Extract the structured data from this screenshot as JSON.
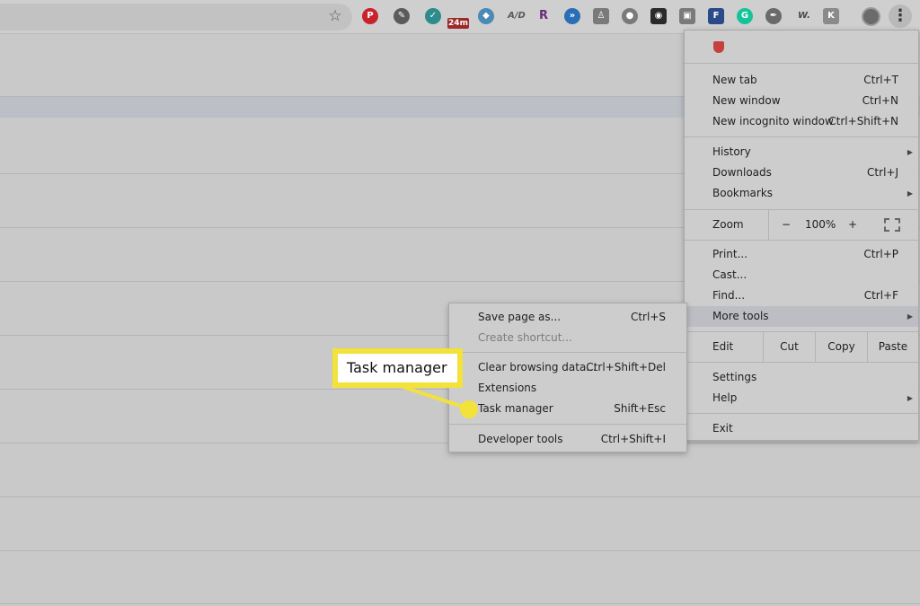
{
  "toolbar": {
    "star_icon": "bookmark-star-icon",
    "extensions": [
      {
        "name": "pinterest-icon",
        "color": "#c8232c",
        "glyph": "P"
      },
      {
        "name": "eyedropper-icon",
        "color": "#5b5b5b",
        "glyph": "✎"
      },
      {
        "name": "shield-check-icon",
        "color": "#2e8b8b",
        "glyph": "✓"
      },
      {
        "name": "badge-24m-icon",
        "color": "#9c2a2a",
        "glyph": "24m"
      },
      {
        "name": "diamond-icon",
        "color": "#4a8ab5",
        "glyph": "◆"
      },
      {
        "name": "aid-icon",
        "color": "#5a5a5a",
        "glyph": "A/D"
      },
      {
        "name": "r-icon",
        "color": "#6b2a7a",
        "glyph": "R"
      },
      {
        "name": "arrows-icon",
        "color": "#2a6fb5",
        "glyph": "»"
      },
      {
        "name": "person-icon",
        "color": "#7a7a7a",
        "glyph": "♙"
      },
      {
        "name": "acorn-icon",
        "color": "#7a7a7a",
        "glyph": "●"
      },
      {
        "name": "owl-icon",
        "color": "#2a2a2a",
        "glyph": "◉"
      },
      {
        "name": "briefcase-icon",
        "color": "#7a7a7a",
        "glyph": "▣"
      },
      {
        "name": "f-icon",
        "color": "#2a4a8a",
        "glyph": "F"
      },
      {
        "name": "grammarly-icon",
        "color": "#15c39a",
        "glyph": "G"
      },
      {
        "name": "feather-icon",
        "color": "#6a6a6a",
        "glyph": "✒"
      },
      {
        "name": "w-icon",
        "color": "#4a4a4a",
        "glyph": "W."
      },
      {
        "name": "k-icon",
        "color": "#8a8a8a",
        "glyph": "K"
      }
    ]
  },
  "menu": {
    "new_tab": "New tab",
    "new_tab_sc": "Ctrl+T",
    "new_window": "New window",
    "new_window_sc": "Ctrl+N",
    "new_incognito": "New incognito window",
    "new_incognito_sc": "Ctrl+Shift+N",
    "history": "History",
    "downloads": "Downloads",
    "downloads_sc": "Ctrl+J",
    "bookmarks": "Bookmarks",
    "zoom": "Zoom",
    "zoom_minus": "−",
    "zoom_value": "100%",
    "zoom_plus": "+",
    "print": "Print...",
    "print_sc": "Ctrl+P",
    "cast": "Cast...",
    "find": "Find...",
    "find_sc": "Ctrl+F",
    "more_tools": "More tools",
    "edit": "Edit",
    "cut": "Cut",
    "copy": "Copy",
    "paste": "Paste",
    "settings": "Settings",
    "help": "Help",
    "exit": "Exit"
  },
  "submenu": {
    "save_page": "Save page as...",
    "save_page_sc": "Ctrl+S",
    "create_shortcut": "Create shortcut...",
    "clear_browsing": "Clear browsing data...",
    "clear_browsing_sc": "Ctrl+Shift+Del",
    "extensions": "Extensions",
    "task_manager": "Task manager",
    "task_manager_sc": "Shift+Esc",
    "developer_tools": "Developer tools",
    "developer_tools_sc": "Ctrl+Shift+I"
  },
  "callout": {
    "text": "Task manager",
    "color": "#f2e23a"
  }
}
